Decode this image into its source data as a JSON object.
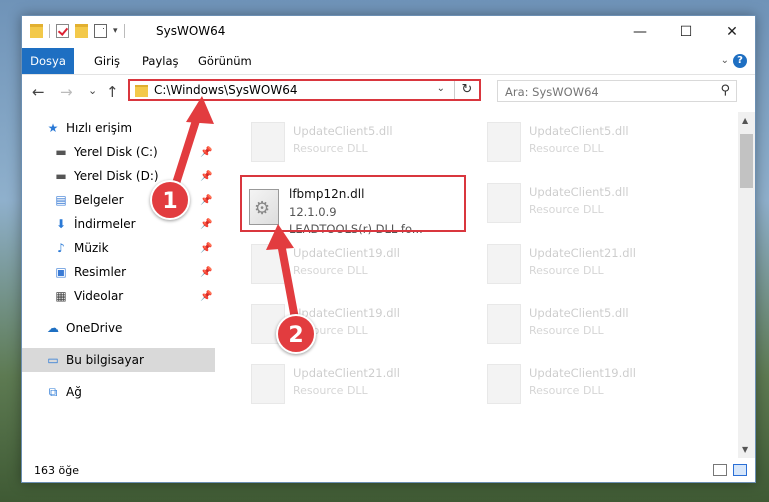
{
  "window": {
    "title": "SysWOW64",
    "minimize": "—",
    "maximize": "☐",
    "close": "✕"
  },
  "ribbon": {
    "tabs": [
      "Dosya",
      "Giriş",
      "Paylaş",
      "Görünüm"
    ],
    "help": "?"
  },
  "nav": {
    "back": "←",
    "forward": "→",
    "recent": "⌄",
    "up": "↑",
    "address": "C:\\Windows\\SysWOW64",
    "refresh": "↻",
    "search_placeholder": "Ara: SysWOW64"
  },
  "sidebar": {
    "items": [
      {
        "label": "Hızlı erişim",
        "icon": "star-icon"
      },
      {
        "label": "Yerel Disk (C:)",
        "icon": "drive-icon"
      },
      {
        "label": "Yerel Disk (D:)",
        "icon": "drive-icon"
      },
      {
        "label": "Belgeler",
        "icon": "documents-icon"
      },
      {
        "label": "İndirmeler",
        "icon": "download-icon"
      },
      {
        "label": "Müzik",
        "icon": "music-icon"
      },
      {
        "label": "Resimler",
        "icon": "pictures-icon"
      },
      {
        "label": "Videolar",
        "icon": "videos-icon"
      },
      {
        "label": "OneDrive",
        "icon": "cloud-icon"
      },
      {
        "label": "Bu bilgisayar",
        "icon": "computer-icon"
      },
      {
        "label": "Ağ",
        "icon": "network-icon"
      }
    ]
  },
  "files": {
    "highlighted": {
      "name": "lfbmp12n.dll",
      "version": "12.1.0.9",
      "description": "LEADTOOLS(r) DLL fo..."
    },
    "ghost_left": [
      {
        "name": "UpdateClient5.dll",
        "type": "Resource DLL"
      },
      {
        "name": "UpdateClient19.dll",
        "type": "Resource DLL"
      },
      {
        "name": "UpdateClient19.dll",
        "type": "Resource DLL"
      },
      {
        "name": "UpdateClient21.dll",
        "type": "Resource DLL"
      }
    ],
    "ghost_right": [
      {
        "name": "UpdateClient5.dll",
        "type": "Resource DLL"
      },
      {
        "name": "UpdateClient5.dll",
        "type": "Resource DLL"
      },
      {
        "name": "UpdateClient21.dll",
        "type": "Resource DLL"
      },
      {
        "name": "UpdateClient5.dll",
        "type": "Resource DLL"
      },
      {
        "name": "UpdateClient19.dll",
        "type": "Resource DLL"
      }
    ]
  },
  "status": {
    "count": "163 öğe"
  },
  "annotations": {
    "step1": "1",
    "step2": "2",
    "color": "#e23c3f"
  }
}
